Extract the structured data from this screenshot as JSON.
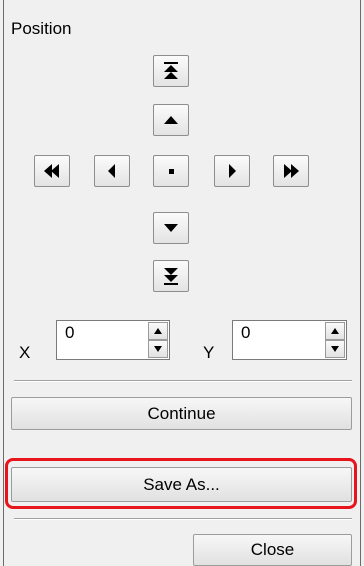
{
  "panel": {
    "title": "Position"
  },
  "nav_buttons": [
    {
      "name": "move-top-button",
      "icon": "double-arrow-up-icon"
    },
    {
      "name": "move-up-button",
      "icon": "arrow-up-icon"
    },
    {
      "name": "move-far-left-button",
      "icon": "double-arrow-left-icon"
    },
    {
      "name": "move-left-button",
      "icon": "arrow-left-icon"
    },
    {
      "name": "center-button",
      "icon": "center-dot-icon"
    },
    {
      "name": "move-right-button",
      "icon": "arrow-right-icon"
    },
    {
      "name": "move-far-right-button",
      "icon": "double-arrow-right-icon"
    },
    {
      "name": "move-down-button",
      "icon": "arrow-down-icon"
    },
    {
      "name": "move-bottom-button",
      "icon": "double-arrow-down-icon"
    }
  ],
  "coords": {
    "x_label": "X",
    "x_value": "0",
    "y_label": "Y",
    "y_value": "0"
  },
  "buttons": {
    "continue_label": "Continue",
    "save_as_label": "Save As...",
    "close_label": "Close"
  },
  "colors": {
    "highlight": "#e8141c",
    "panel_bg": "#f0f0f0",
    "icon": "#000000"
  }
}
